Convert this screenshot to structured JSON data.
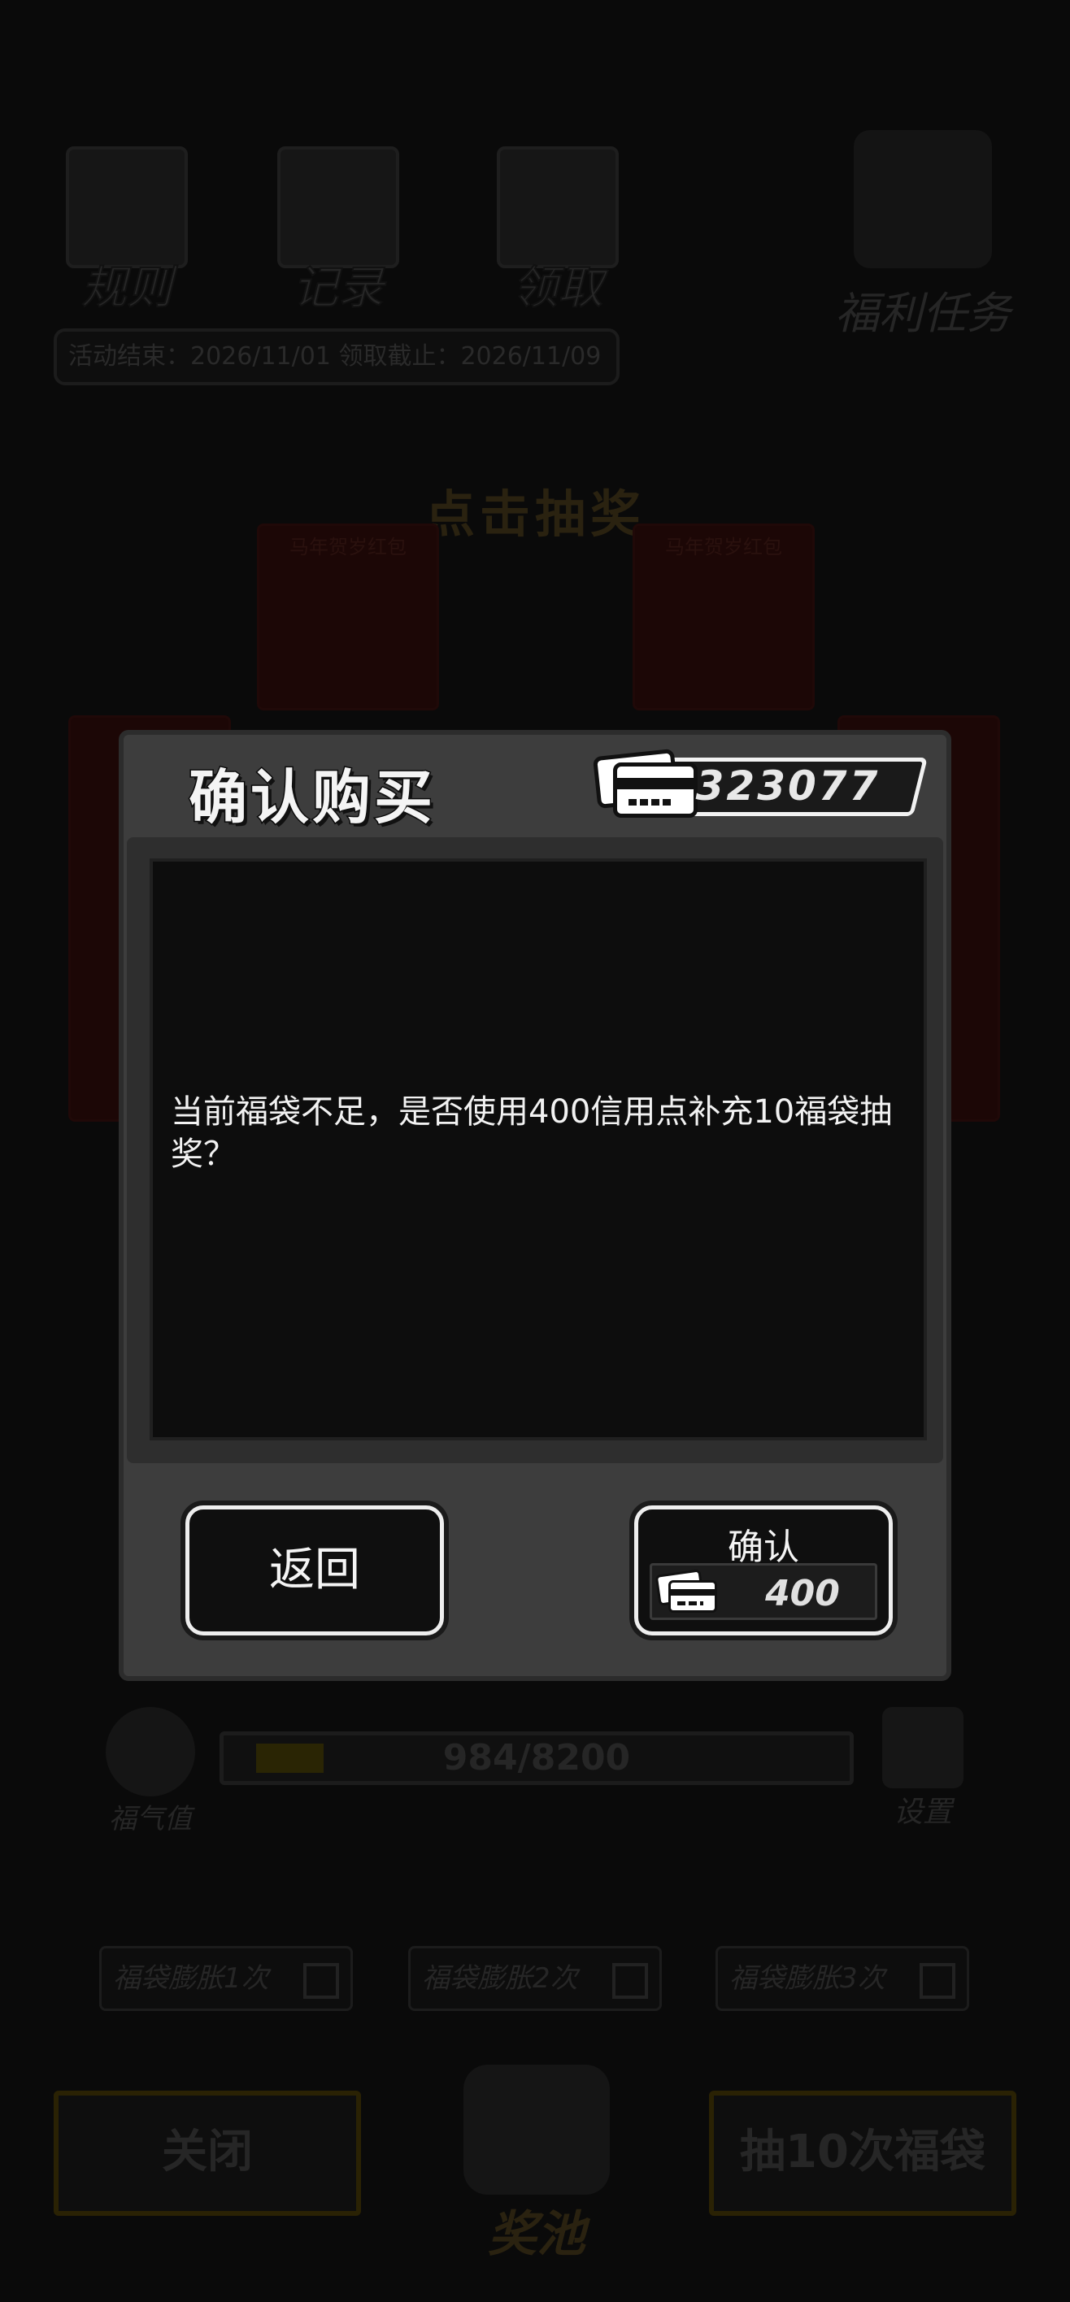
{
  "background": {
    "top_icons": [
      "规则",
      "记录",
      "领取"
    ],
    "welfare_task": "福利任务",
    "date_bar": "活动结束：2026/11/01  领取截止：2026/11/09",
    "draw_title": "点击抽奖",
    "envelope_captions": [
      "马年贺岁红包",
      "马年贺岁红包"
    ],
    "luck_label": "福气值",
    "progress_text": "984/8200",
    "progress_value": 984,
    "progress_max": 8200,
    "settings_label": "设置",
    "boost_options": [
      "福袋膨胀1次",
      "福袋膨胀2次",
      "福袋膨胀3次"
    ],
    "close_label": "关闭",
    "pool_label": "奖池",
    "draw10_label": "抽10次福袋"
  },
  "dialog": {
    "title": "确认购买",
    "balance": "323077",
    "message": "当前福袋不足，是否使用400信用点补充10福袋抽奖？",
    "back_label": "返回",
    "confirm_label": "确认",
    "confirm_price": "400",
    "currency_icon": "credit-card-icon"
  },
  "colors": {
    "dialog_bg": "#3d3d3d",
    "message_bg": "#0d0d0d",
    "overlay": "#050505",
    "button_border": "#eeeeee"
  }
}
